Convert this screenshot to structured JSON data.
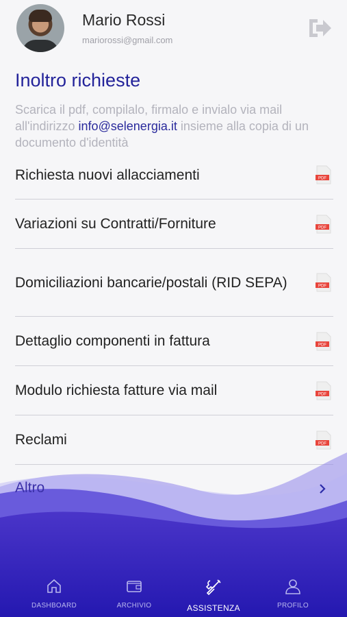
{
  "user": {
    "name": "Mario Rossi",
    "email": "mariorossi@gmail.com"
  },
  "page": {
    "title": "Inoltro richieste",
    "desc_before": "Scarica il pdf, compilalo, firmalo e invialo via mail all'indirizzo ",
    "desc_link": "info@selenergia.it",
    "desc_after": " insieme alla copia di un documento d'identità"
  },
  "items": [
    {
      "label": "Richiesta nuovi allacciamenti",
      "icon": "pdf-icon"
    },
    {
      "label": "Variazioni su Contratti/Forniture",
      "icon": "pdf-icon"
    },
    {
      "label": "Domiciliazioni bancarie/postali (RID SEPA)",
      "icon": "pdf-icon"
    },
    {
      "label": "Dettaglio componenti in fattura",
      "icon": "pdf-icon"
    },
    {
      "label": "Modulo richiesta fatture via mail",
      "icon": "pdf-icon"
    },
    {
      "label": "Reclami",
      "icon": "pdf-icon"
    }
  ],
  "altro": {
    "label": "Altro",
    "icon": "chevron-right-icon"
  },
  "nav": [
    {
      "label": "DASHBOARD",
      "icon": "home-icon",
      "active": false
    },
    {
      "label": "ARCHIVIO",
      "icon": "wallet-icon",
      "active": false
    },
    {
      "label": "ASSISTENZA",
      "icon": "tools-icon",
      "active": true
    },
    {
      "label": "PROFILO",
      "icon": "user-icon",
      "active": false
    }
  ],
  "colors": {
    "accent": "#23239a",
    "wave_dark": "#2a1db8",
    "wave_light": "#7a6ee8"
  }
}
